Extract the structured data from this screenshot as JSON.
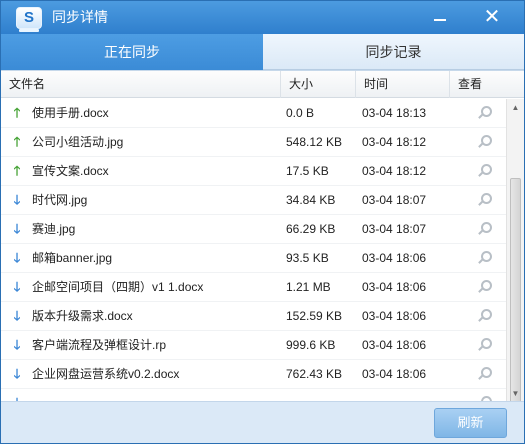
{
  "window": {
    "title": "同步详情",
    "logo_text": "S",
    "minimize_icon": "minimize-icon",
    "close_glyph": "✕"
  },
  "tabs": [
    {
      "label": "正在同步",
      "active": true
    },
    {
      "label": "同步记录",
      "active": false
    }
  ],
  "table": {
    "headers": {
      "name": "文件名",
      "size": "大小",
      "time": "时间",
      "view": "查看"
    },
    "rows": [
      {
        "direction": "upload",
        "arrow": "🡑",
        "name": "使用手册.docx",
        "size": "0.0 B",
        "time": "03-04 18:13"
      },
      {
        "direction": "upload",
        "arrow": "🡑",
        "name": "公司小组活动.jpg",
        "size": "548.12 KB",
        "time": "03-04 18:12"
      },
      {
        "direction": "upload",
        "arrow": "🡑",
        "name": "宣传文案.docx",
        "size": "17.5 KB",
        "time": "03-04 18:12"
      },
      {
        "direction": "download",
        "arrow": "🡓",
        "name": "时代网.jpg",
        "size": "34.84 KB",
        "time": "03-04 18:07"
      },
      {
        "direction": "download",
        "arrow": "🡓",
        "name": "赛迪.jpg",
        "size": "66.29 KB",
        "time": "03-04 18:07"
      },
      {
        "direction": "download",
        "arrow": "🡓",
        "name": "邮箱banner.jpg",
        "size": "93.5 KB",
        "time": "03-04 18:06"
      },
      {
        "direction": "download",
        "arrow": "🡓",
        "name": "企邮空间项目（四期）v1 1.docx",
        "size": "1.21 MB",
        "time": "03-04 18:06"
      },
      {
        "direction": "download",
        "arrow": "🡓",
        "name": "版本升级需求.docx",
        "size": "152.59 KB",
        "time": "03-04 18:06"
      },
      {
        "direction": "download",
        "arrow": "🡓",
        "name": "客户端流程及弹框设计.rp",
        "size": "999.6 KB",
        "time": "03-04 18:06"
      },
      {
        "direction": "download",
        "arrow": "🡓",
        "name": "企业网盘运营系统v0.2.docx",
        "size": "762.43 KB",
        "time": "03-04 18:06"
      },
      {
        "direction": "download",
        "arrow": "🡓",
        "name": "",
        "size": "",
        "time": ""
      }
    ]
  },
  "scrollbar": {
    "up_glyph": "▲",
    "down_glyph": "▼"
  },
  "footer": {
    "refresh_label": "刷新"
  },
  "colors": {
    "titlebar": "#3a8ad6",
    "active_tab": "#4494de",
    "upload_arrow": "#4aa53a",
    "download_arrow": "#3c87d6",
    "refresh_button": "#8fc0ec"
  }
}
